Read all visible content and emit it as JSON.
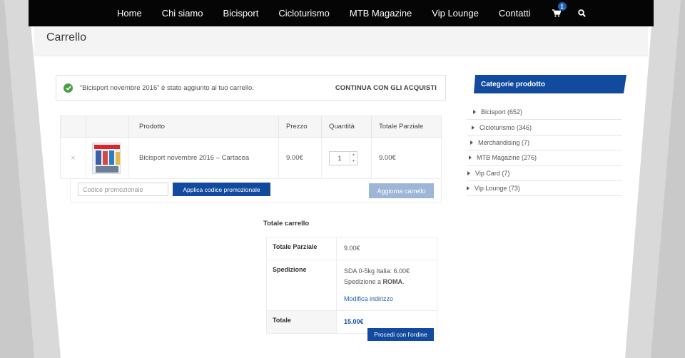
{
  "nav": {
    "items": [
      "Home",
      "Chi siamo",
      "Bicisport",
      "Cicloturismo",
      "MTB Magazine",
      "Vip Lounge",
      "Contatti"
    ],
    "cart_count": "1",
    "cart_icon": "cart-icon",
    "search_icon": "search-icon"
  },
  "page": {
    "title": "Carrello"
  },
  "notice": {
    "message": "“Bicisport novembre 2016” è stato aggiunto al tuo carrello.",
    "link": "CONTINUA CON GLI ACQUISTI"
  },
  "cart": {
    "headers": {
      "product": "Prodotto",
      "price": "Prezzo",
      "qty": "Quantità",
      "subtotal": "Totale Parziale"
    },
    "rows": [
      {
        "remove": "×",
        "name": "Bicisport novembre 2016 – Cartacea",
        "price": "9.00€",
        "qty": "1",
        "subtotal": "9.00€"
      }
    ],
    "coupon_placeholder": "Codice promozionale",
    "apply_label": "Applica codice promozionale",
    "update_label": "Aggiorna carrello"
  },
  "totals": {
    "title": "Totale carrello",
    "subtotal_label": "Totale Parziale",
    "subtotal_value": "9.00€",
    "shipping_label": "Spedizione",
    "shipping_method": "SDA 0-5kg Italia: 6.00€",
    "shipping_to_prefix": "Spedizione a ",
    "shipping_to_city": "ROMA",
    "shipping_to_suffix": ".",
    "change_address": "Modifica indirizzo",
    "total_label": "Totale",
    "total_value": "15.00€",
    "checkout_label": "Procedi con l'ordine"
  },
  "sidebar": {
    "title": "Categorie prodotto",
    "items": [
      "Bicisport (652)",
      "Cicloturismo (346)",
      "Merchandising (7)",
      "MTB Magazine (276)",
      "Vip Card (7)",
      "Vip Lounge (73)"
    ]
  },
  "colors": {
    "brand_blue": "#114a9f",
    "nav_bg": "#050505",
    "success": "#4ba046"
  }
}
